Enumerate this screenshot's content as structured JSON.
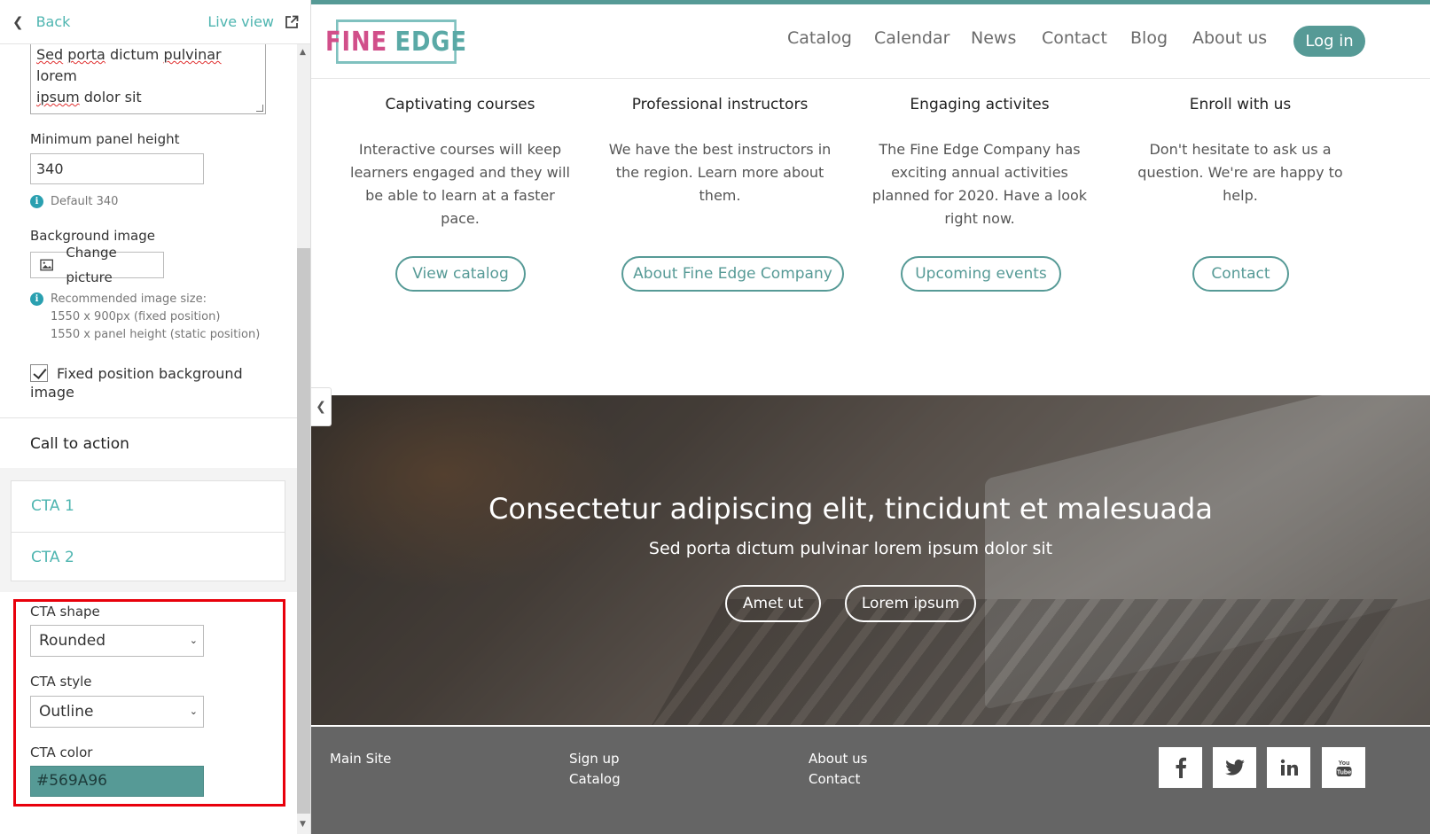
{
  "panel": {
    "back_label": "Back",
    "live_view_label": "Live view",
    "textarea_line1_a": "Sed",
    "textarea_line1_b": "porta",
    "textarea_line1_c": " dictum ",
    "textarea_line1_d": "pulvinar",
    "textarea_line1_e": " lorem",
    "textarea_line2_a": "ipsum",
    "textarea_line2_b": " dolor sit",
    "min_height_label": "Minimum panel height",
    "min_height_value": "340",
    "min_height_hint": "Default 340",
    "bg_image_label": "Background image",
    "change_picture_label": "Change picture",
    "rec_hint_line1": "Recommended image size:",
    "rec_hint_line2": "1550 x 900px (fixed position)",
    "rec_hint_line3": "1550 x panel height (static position)",
    "fixed_bg_label": "Fixed position background image",
    "cta_section_title": "Call to action",
    "cta_items": [
      "CTA 1",
      "CTA 2"
    ],
    "cta_shape_label": "CTA shape",
    "cta_shape_value": "Rounded",
    "cta_style_label": "CTA style",
    "cta_style_value": "Outline",
    "cta_color_label": "CTA color",
    "cta_color_value": "#569A96"
  },
  "site": {
    "logo_fine": "FINE",
    "logo_edge": "EDGE",
    "nav": [
      "Catalog",
      "Calendar",
      "News",
      "Contact",
      "Blog",
      "About us"
    ],
    "login_label": "Log in",
    "features": [
      {
        "title": "Captivating courses",
        "text": "Interactive courses will keep learners engaged and they will be able to learn at a faster pace.",
        "button": "View catalog"
      },
      {
        "title": "Professional instructors",
        "text": "We have the best instructors in the region. Learn more about them.",
        "button": "About Fine Edge Company"
      },
      {
        "title": "Engaging activites",
        "text": "The Fine Edge Company has exciting annual activities planned for 2020. Have a look right now.",
        "button": "Upcoming events"
      },
      {
        "title": "Enroll with us",
        "text": "Don't hesitate to ask us a question. We're are happy to help.",
        "button": "Contact"
      }
    ],
    "hero_title": "Consectetur adipiscing elit, tincidunt et malesuada",
    "hero_subtitle": "Sed porta dictum pulvinar lorem ipsum dolor sit",
    "hero_buttons": [
      "Amet ut",
      "Lorem ipsum"
    ],
    "footer_links": {
      "col1": [
        "Main Site"
      ],
      "col2": [
        "Sign up",
        "Catalog"
      ],
      "col3": [
        "About us",
        "Contact"
      ]
    },
    "social": [
      "facebook-icon",
      "twitter-icon",
      "linkedin-icon",
      "youtube-icon"
    ]
  },
  "colors": {
    "accent": "#569A96",
    "link": "#4eb5b0",
    "logo_pink": "#d14f8a",
    "footer": "#656565",
    "highlight": "#e8000b"
  }
}
